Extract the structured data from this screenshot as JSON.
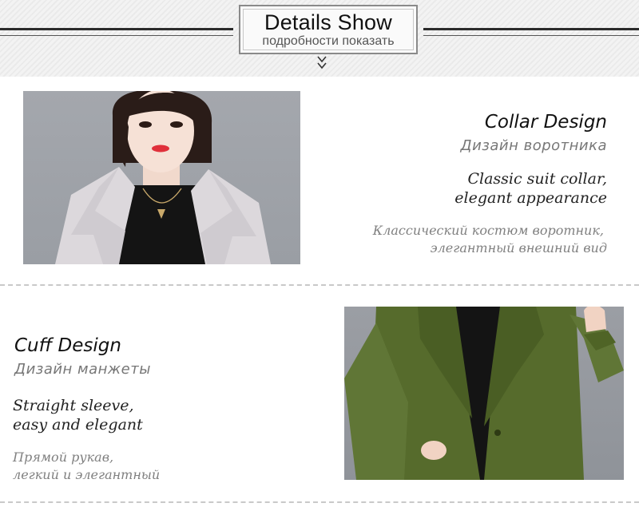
{
  "header": {
    "title_en": "Details Show",
    "title_ru": "подробности показать"
  },
  "collar": {
    "heading_en": "Collar Design",
    "heading_ru": "Дизайн воротника",
    "desc_en_1": "Classic suit collar,",
    "desc_en_2": "elegant appearance",
    "desc_ru_1": "Классический костюм воротник,",
    "desc_ru_2": "элегантный внешний вид",
    "coat_color": "#d9d6d9"
  },
  "cuff": {
    "heading_en": "Cuff Design",
    "heading_ru": "Дизайн манжеты",
    "desc_en_1": "Straight sleeve,",
    "desc_en_2": "easy and elegant",
    "desc_ru_1": "Прямой рукав,",
    "desc_ru_2": "легкий и элегантный",
    "coat_color": "#556b2f"
  }
}
